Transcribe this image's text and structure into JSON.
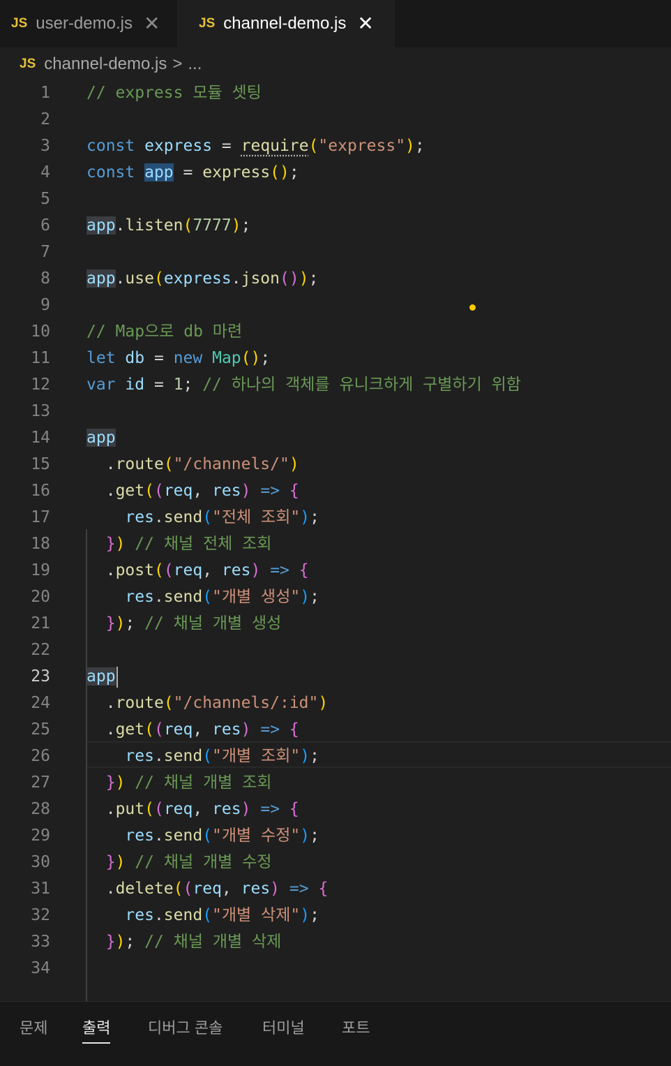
{
  "tabs": [
    {
      "badge": "JS",
      "label": "user-demo.js",
      "close": "✕"
    },
    {
      "badge": "JS",
      "label": "channel-demo.js",
      "close": "✕"
    }
  ],
  "breadcrumb": {
    "badge": "JS",
    "file": "channel-demo.js",
    "separator": ">",
    "more": "..."
  },
  "editor": {
    "line_numbers": [
      "1",
      "2",
      "3",
      "4",
      "5",
      "6",
      "7",
      "8",
      "9",
      "10",
      "11",
      "12",
      "13",
      "14",
      "15",
      "16",
      "17",
      "18",
      "19",
      "20",
      "21",
      "22",
      "23",
      "24",
      "25",
      "26",
      "27",
      "28",
      "29",
      "30",
      "31",
      "32",
      "33",
      "34"
    ],
    "active_line": "23",
    "code": {
      "l1_comment": "// express 모듈 셋팅",
      "const": "const",
      "express": "express",
      "eq": "=",
      "require": "require",
      "express_str": "\"express\"",
      "app": "app",
      "express_call": "express",
      "listen": "listen",
      "port": "7777",
      "use": "use",
      "json": "json",
      "l10_comment": "// Map으로 db 마련",
      "let": "let",
      "db": "db",
      "new": "new",
      "Map": "Map",
      "var": "var",
      "id": "id",
      "one": "1",
      "l12_comment": "// 하나의 객체를 유니크하게 구별하기 위함",
      "route": "route",
      "channels_str": "\"/channels/\"",
      "channels_id_str": "\"/channels/:id\"",
      "get": "get",
      "post": "post",
      "put": "put",
      "delete": "delete",
      "req": "req",
      "res": "res",
      "arrow": "=>",
      "send": "send",
      "s_all_get": "\"전체 조회\"",
      "c_all_get": "// 채널 전체 조회",
      "s_one_create": "\"개별 생성\"",
      "c_one_create": "// 채널 개별 생성",
      "s_one_get": "\"개별 조회\"",
      "c_one_get": "// 채널 개별 조회",
      "s_one_put": "\"개별 수정\"",
      "c_one_put": "// 채널 개별 수정",
      "s_one_del": "\"개별 삭제\"",
      "c_one_del": "// 채널 개별 삭제"
    }
  },
  "panel": {
    "tabs": [
      "문제",
      "출력",
      "디버그 콘솔",
      "터미널",
      "포트"
    ],
    "active_tab": "출력"
  },
  "colors": {
    "keyword": "#569cd6",
    "variable": "#9cdcfe",
    "function": "#dcdcaa",
    "string": "#ce9178",
    "number": "#b5cea8",
    "comment": "#6a9955",
    "class": "#4ec9b0",
    "js_badge": "#e8c13a",
    "modified_dot": "#ffcc00"
  }
}
